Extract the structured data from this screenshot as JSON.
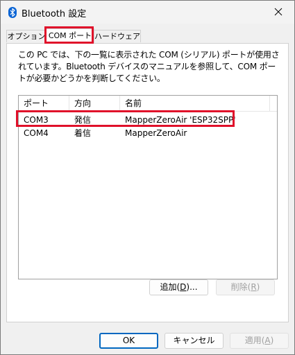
{
  "window": {
    "title": "Bluetooth 設定",
    "close_glyph": "✕"
  },
  "tabs": [
    {
      "label": "オプション",
      "active": false
    },
    {
      "label": "COM ポート",
      "active": true,
      "highlighted": true
    },
    {
      "label": "ハードウェア",
      "active": false
    }
  ],
  "description": "この PC では、下の一覧に表示された COM (シリアル) ポートが使用されています。Bluetooth デバイスのマニュアルを参照して、COM ポートが必要かどうかを判断してください。",
  "table": {
    "columns": [
      "ポート",
      "方向",
      "名前"
    ],
    "rows": [
      {
        "port": "COM3",
        "direction": "発信",
        "name": "MapperZeroAir 'ESP32SPP'",
        "highlighted": true
      },
      {
        "port": "COM4",
        "direction": "着信",
        "name": "MapperZeroAir",
        "highlighted": false
      }
    ]
  },
  "panel_buttons": {
    "add": {
      "label": "追加(",
      "key": "D",
      "suffix": ")..."
    },
    "remove": {
      "label": "削除(",
      "key": "R",
      "suffix": ")"
    }
  },
  "dialog_buttons": {
    "ok": "OK",
    "cancel": "キャンセル",
    "apply": {
      "label": "適用(",
      "key": "A",
      "suffix": ")"
    }
  },
  "colors": {
    "highlight": "#e0102a",
    "accent": "#0067c0",
    "bluetooth_icon": "#0a64d4"
  }
}
